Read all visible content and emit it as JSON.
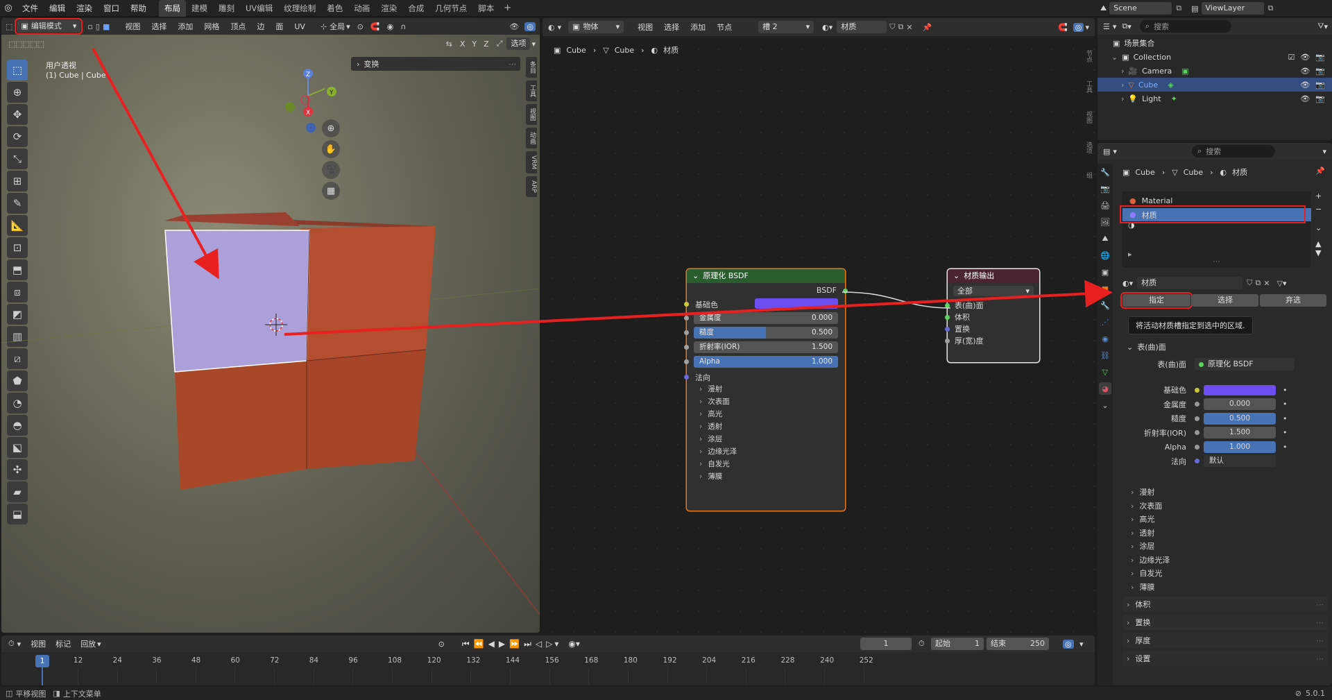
{
  "topbar": {
    "menus": [
      "文件",
      "编辑",
      "渲染",
      "窗口",
      "帮助"
    ],
    "workspaces": [
      "布局",
      "建模",
      "雕刻",
      "UV编辑",
      "纹理绘制",
      "着色",
      "动画",
      "渲染",
      "合成",
      "几何节点",
      "脚本"
    ],
    "active_workspace": "布局",
    "add_tab": "+",
    "scene": "Scene",
    "view_layer": "ViewLayer"
  },
  "viewport": {
    "mode": "编辑模式",
    "header_menus": [
      "视图",
      "选择",
      "添加",
      "网格",
      "顶点",
      "边",
      "面",
      "UV"
    ],
    "transform_orient": "全局",
    "axes": [
      "X",
      "Y",
      "Z"
    ],
    "options_label": "选项",
    "view_name": "用户透视",
    "object_info": "(1) Cube | Cube",
    "transform_panel": "变换",
    "side_tabs": [
      "条目",
      "工具",
      "视图",
      "动画",
      "VRM",
      "ARP"
    ],
    "gizmo": {
      "z": "Z",
      "y": "Y",
      "x": "X"
    },
    "colors": {
      "face_selected": "#aba0d9",
      "face_base": "#b04a2c",
      "top_face": "#8a3b2a"
    }
  },
  "node_editor": {
    "object_menu": "物体",
    "menus": [
      "视图",
      "选择",
      "添加",
      "节点"
    ],
    "slot": "槽 2",
    "material": "材质",
    "breadcrumb": [
      "Cube",
      "Cube",
      "材质"
    ],
    "side_tabs": [
      "节点",
      "工具",
      "视图",
      "选项",
      "组"
    ],
    "bsdf_node": {
      "title": "原理化 BSDF",
      "output": "BSDF",
      "base_color_label": "基础色",
      "base_color": "#6c4df0",
      "fields": [
        {
          "label": "金属度",
          "value": "0.000",
          "fill": 0.0
        },
        {
          "label": "糙度",
          "value": "0.500",
          "fill": 0.5
        },
        {
          "label": "折射率(IOR)",
          "value": "1.500",
          "fill": 0.0
        },
        {
          "label": "Alpha",
          "value": "1.000",
          "fill": 1.0
        }
      ],
      "normal_label": "法向",
      "subpanels": [
        "漫射",
        "次表面",
        "高光",
        "透射",
        "涂层",
        "边缘光泽",
        "自发光",
        "薄膜"
      ]
    },
    "output_node": {
      "title": "材质输出",
      "target": "全部",
      "inputs": [
        "表(曲)面",
        "体积",
        "置换",
        "厚(宽)度"
      ]
    }
  },
  "outliner": {
    "search_placeholder": "搜索",
    "scene_collection": "场景集合",
    "items": [
      {
        "name": "Collection",
        "level": 1
      },
      {
        "name": "Camera",
        "level": 2
      },
      {
        "name": "Cube",
        "level": 2,
        "selected": true
      },
      {
        "name": "Light",
        "level": 2
      }
    ]
  },
  "properties": {
    "search_placeholder": "搜索",
    "breadcrumb": [
      "Cube",
      "Cube",
      "材质"
    ],
    "slots": [
      {
        "name": "Material",
        "selected": false
      },
      {
        "name": "材质",
        "selected": true
      }
    ],
    "material_name": "材质",
    "actions": [
      "指定",
      "选择",
      "弃选"
    ],
    "tooltip": "将活动材质槽指定到选中的区域.",
    "surface_panel": "表(曲)面",
    "surface_label": "表(曲)面",
    "surface_value": "原理化 BSDF",
    "props": [
      {
        "label": "基础色",
        "type": "color",
        "color": "#6c4df0"
      },
      {
        "label": "金属度",
        "value": "0.000"
      },
      {
        "label": "糙度",
        "value": "0.500",
        "blue": true
      },
      {
        "label": "折射率(IOR)",
        "value": "1.500"
      },
      {
        "label": "Alpha",
        "value": "1.000",
        "blue": true
      },
      {
        "label": "法向",
        "value": "默认"
      }
    ],
    "subpanels": [
      "漫射",
      "次表面",
      "高光",
      "透射",
      "涂层",
      "边缘光泽",
      "自发光",
      "薄膜"
    ],
    "panels": [
      "体积",
      "置换",
      "厚度",
      "设置"
    ]
  },
  "timeline": {
    "menus": [
      "视图",
      "标记"
    ],
    "playback": "回放",
    "current_frame": "1",
    "start_label": "起始",
    "start": "1",
    "end_label": "结束",
    "end": "250",
    "ticks": [
      "1",
      "12",
      "24",
      "36",
      "48",
      "60",
      "72",
      "84",
      "96",
      "108",
      "120",
      "132",
      "144",
      "156",
      "168",
      "180",
      "192",
      "204",
      "216",
      "228",
      "240",
      "252"
    ]
  },
  "statusbar": {
    "left1": "平移视图",
    "left2": "上下文菜单",
    "version": "5.0.1"
  },
  "annotation": {
    "color": "#e82020"
  }
}
